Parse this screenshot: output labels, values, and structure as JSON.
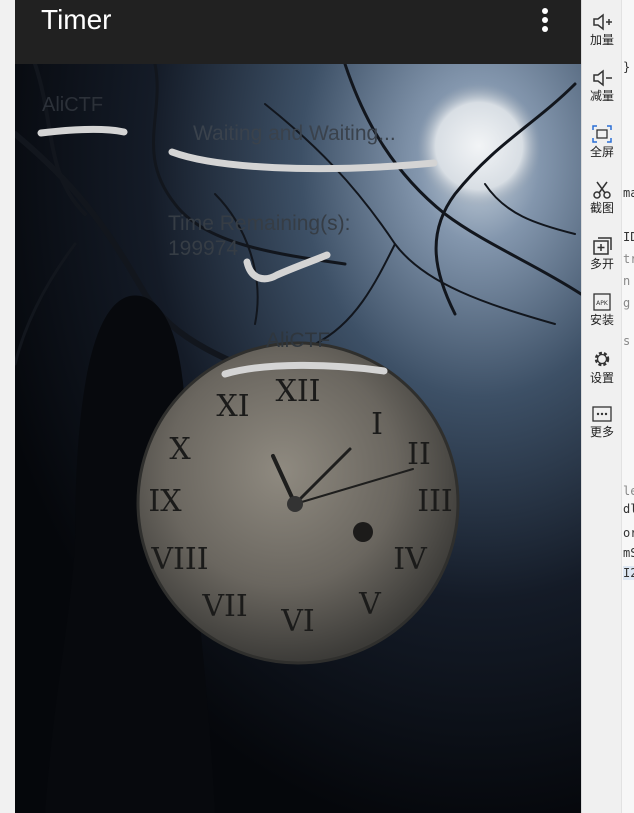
{
  "app": {
    "title": "Timer",
    "label_top": "AliCTF",
    "status": "Waiting and Waiting...",
    "time_remaining_label": "Time Remaining(s):",
    "time_remaining_value": "199974",
    "label_bottom": "AliCTF"
  },
  "sidebar": {
    "tools": [
      {
        "label": "加量",
        "icon": "volume-up-icon"
      },
      {
        "label": "减量",
        "icon": "volume-down-icon"
      },
      {
        "label": "全屏",
        "icon": "fullscreen-icon"
      },
      {
        "label": "截图",
        "icon": "scissors-icon"
      },
      {
        "label": "多开",
        "icon": "multi-open-icon"
      },
      {
        "label": "安装",
        "icon": "apk-install-icon"
      },
      {
        "label": "设置",
        "icon": "gear-icon"
      },
      {
        "label": "更多",
        "icon": "more-icon"
      }
    ]
  },
  "code_peek": [
    "}",
    "ma",
    "ID",
    "tr",
    "n",
    "g",
    "s",
    "le",
    "dl",
    "or",
    "mS",
    "I2"
  ],
  "colors": {
    "appbar": "#212121",
    "sidebar": "#f0f0f0",
    "scribble": "#d8d8d8"
  }
}
